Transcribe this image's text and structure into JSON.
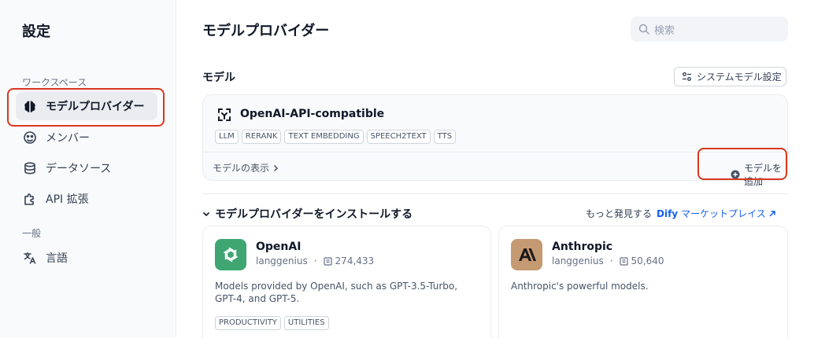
{
  "sidebar": {
    "title": "設定",
    "workspace_label": "ワークスペース",
    "general_label": "一般",
    "items": [
      {
        "label": "モデルプロバイダー",
        "icon": "brain-icon",
        "active": true
      },
      {
        "label": "メンバー",
        "icon": "members-icon"
      },
      {
        "label": "データソース",
        "icon": "database-icon"
      },
      {
        "label": "API 拡張",
        "icon": "puzzle-icon"
      },
      {
        "label": "言語",
        "icon": "translate-icon"
      }
    ]
  },
  "header": {
    "title": "モデルプロバイダー",
    "search_placeholder": "検索"
  },
  "models_section": {
    "title": "モデル",
    "system_settings_label": "システムモデル設定"
  },
  "provider": {
    "name": "OpenAI-API-compatible",
    "tags": [
      "LLM",
      "RERANK",
      "TEXT EMBEDDING",
      "SPEECH2TEXT",
      "TTS"
    ],
    "view_models_label": "モデルの表示",
    "add_model_label": "モデルを追加"
  },
  "install_section": {
    "title": "モデルプロバイダーをインストールする",
    "market_prefix": "もっと発見する",
    "market_brand": "Dify",
    "market_link": "マーケットプレイス"
  },
  "plugins": [
    {
      "name": "OpenAI",
      "author": "langgenius",
      "installs": "274,433",
      "desc_line1": "Models provided by OpenAI, such as GPT-3.5-Turbo,",
      "desc_line2": "GPT-4, and GPT-5.",
      "tags": [
        "PRODUCTIVITY",
        "UTILITIES"
      ],
      "icon_color": "#3fa672"
    },
    {
      "name": "Anthropic",
      "author": "langgenius",
      "installs": "50,640",
      "desc_line1": "Anthropic's powerful models.",
      "desc_line2": "",
      "tags": [],
      "icon_color": "#c59a72"
    }
  ],
  "colors": {
    "highlight": "#d9381e",
    "link": "#155eef"
  }
}
